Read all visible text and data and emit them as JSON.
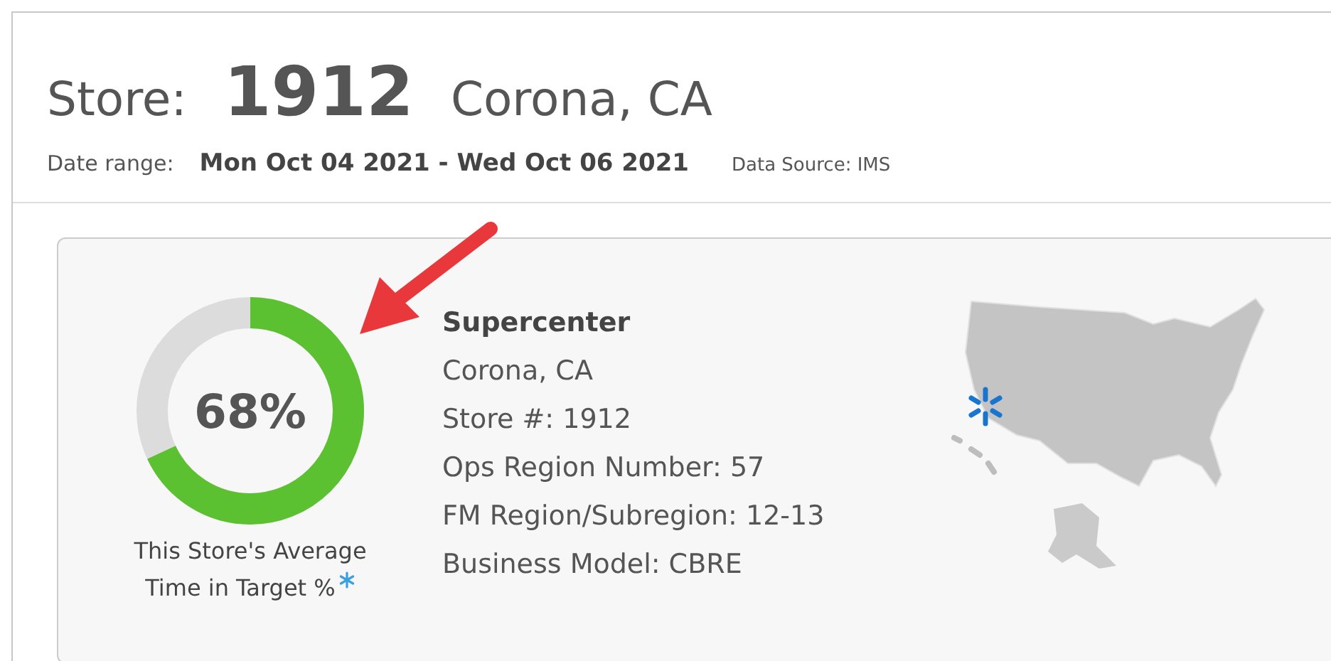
{
  "header": {
    "label": "Store:",
    "store_number": "1912",
    "location": "Corona, CA"
  },
  "date_range": {
    "label": "Date range:",
    "value": "Mon Oct 04 2021 - Wed Oct 06 2021",
    "source": "Data Source: IMS"
  },
  "gauge": {
    "level": 0.68,
    "reading": "68%",
    "caption_line_1": "This Store's Average",
    "caption_line_2": "Time in Target %"
  },
  "details": {
    "title": "Supercenter",
    "lines": [
      "Corona, CA",
      "Store #: 1912",
      "Ops Region Number: 57",
      "FM Region/Subregion: 12-13",
      "Business Model: CBRE"
    ]
  }
}
